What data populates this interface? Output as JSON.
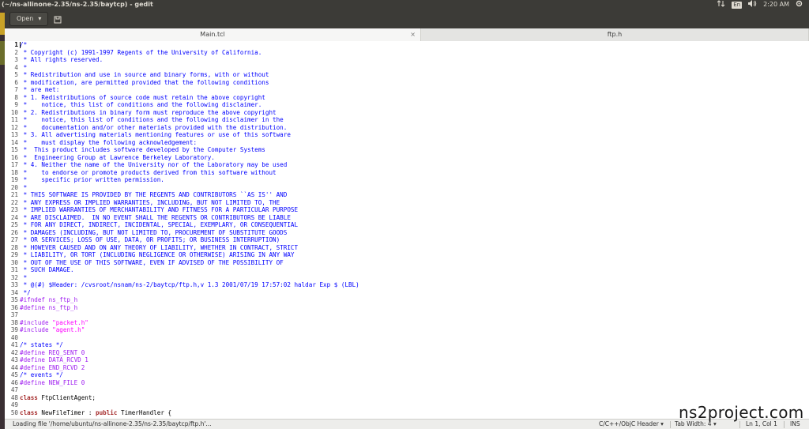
{
  "topbar": {
    "title": "(~/ns-allinone-2.35/ns-2.35/baytcp) - gedit",
    "lang": "En",
    "time": "2:20 AM"
  },
  "toolbar": {
    "open_label": "Open",
    "open_chevron": "▾"
  },
  "tabs": [
    {
      "label": "Main.tcl",
      "close": "×"
    },
    {
      "label": "ftp.h"
    }
  ],
  "lines": [
    {
      "n": "1",
      "t": "/*",
      "c": "c-comment"
    },
    {
      "n": "2",
      "t": " * Copyright (c) 1991-1997 Regents of the University of California.",
      "c": "c-comment"
    },
    {
      "n": "3",
      "t": " * All rights reserved.",
      "c": "c-comment"
    },
    {
      "n": "4",
      "t": " *",
      "c": "c-comment"
    },
    {
      "n": "5",
      "t": " * Redistribution and use in source and binary forms, with or without",
      "c": "c-comment"
    },
    {
      "n": "6",
      "t": " * modification, are permitted provided that the following conditions",
      "c": "c-comment"
    },
    {
      "n": "7",
      "t": " * are met:",
      "c": "c-comment"
    },
    {
      "n": "8",
      "t": " * 1. Redistributions of source code must retain the above copyright",
      "c": "c-comment"
    },
    {
      "n": "9",
      "t": " *    notice, this list of conditions and the following disclaimer.",
      "c": "c-comment"
    },
    {
      "n": "10",
      "t": " * 2. Redistributions in binary form must reproduce the above copyright",
      "c": "c-comment"
    },
    {
      "n": "11",
      "t": " *    notice, this list of conditions and the following disclaimer in the",
      "c": "c-comment"
    },
    {
      "n": "12",
      "t": " *    documentation and/or other materials provided with the distribution.",
      "c": "c-comment"
    },
    {
      "n": "13",
      "t": " * 3. All advertising materials mentioning features or use of this software",
      "c": "c-comment"
    },
    {
      "n": "14",
      "t": " *    must display the following acknowledgement:",
      "c": "c-comment"
    },
    {
      "n": "15",
      "t": " *  This product includes software developed by the Computer Systems",
      "c": "c-comment"
    },
    {
      "n": "16",
      "t": " *  Engineering Group at Lawrence Berkeley Laboratory.",
      "c": "c-comment"
    },
    {
      "n": "17",
      "t": " * 4. Neither the name of the University nor of the Laboratory may be used",
      "c": "c-comment"
    },
    {
      "n": "18",
      "t": " *    to endorse or promote products derived from this software without",
      "c": "c-comment"
    },
    {
      "n": "19",
      "t": " *    specific prior written permission.",
      "c": "c-comment"
    },
    {
      "n": "20",
      "t": " *",
      "c": "c-comment"
    },
    {
      "n": "21",
      "t": " * THIS SOFTWARE IS PROVIDED BY THE REGENTS AND CONTRIBUTORS ``AS IS'' AND",
      "c": "c-comment"
    },
    {
      "n": "22",
      "t": " * ANY EXPRESS OR IMPLIED WARRANTIES, INCLUDING, BUT NOT LIMITED TO, THE",
      "c": "c-comment"
    },
    {
      "n": "23",
      "t": " * IMPLIED WARRANTIES OF MERCHANTABILITY AND FITNESS FOR A PARTICULAR PURPOSE",
      "c": "c-comment"
    },
    {
      "n": "24",
      "t": " * ARE DISCLAIMED.  IN NO EVENT SHALL THE REGENTS OR CONTRIBUTORS BE LIABLE",
      "c": "c-comment"
    },
    {
      "n": "25",
      "t": " * FOR ANY DIRECT, INDIRECT, INCIDENTAL, SPECIAL, EXEMPLARY, OR CONSEQUENTIAL",
      "c": "c-comment"
    },
    {
      "n": "26",
      "t": " * DAMAGES (INCLUDING, BUT NOT LIMITED TO, PROCUREMENT OF SUBSTITUTE GOODS",
      "c": "c-comment"
    },
    {
      "n": "27",
      "t": " * OR SERVICES; LOSS OF USE, DATA, OR PROFITS; OR BUSINESS INTERRUPTION)",
      "c": "c-comment"
    },
    {
      "n": "28",
      "t": " * HOWEVER CAUSED AND ON ANY THEORY OF LIABILITY, WHETHER IN CONTRACT, STRICT",
      "c": "c-comment"
    },
    {
      "n": "29",
      "t": " * LIABILITY, OR TORT (INCLUDING NEGLIGENCE OR OTHERWISE) ARISING IN ANY WAY",
      "c": "c-comment"
    },
    {
      "n": "30",
      "t": " * OUT OF THE USE OF THIS SOFTWARE, EVEN IF ADVISED OF THE POSSIBILITY OF",
      "c": "c-comment"
    },
    {
      "n": "31",
      "t": " * SUCH DAMAGE.",
      "c": "c-comment"
    },
    {
      "n": "32",
      "t": " *",
      "c": "c-comment"
    },
    {
      "n": "33",
      "t": " * @(#) $Header: /cvsroot/nsnam/ns-2/baytcp/ftp.h,v 1.3 2001/07/19 17:57:02 haldar Exp $ (LBL)",
      "c": "c-comment"
    },
    {
      "n": "34",
      "t": " */",
      "c": "c-comment"
    },
    {
      "n": "35",
      "t": "#ifndef ns_ftp_h",
      "c": "c-pre"
    },
    {
      "n": "36",
      "t": "#define ns_ftp_h",
      "c": "c-pre"
    },
    {
      "n": "37",
      "t": "",
      "c": "c-plain"
    },
    {
      "n": "38",
      "parts": [
        {
          "t": "#include ",
          "c": "c-pre"
        },
        {
          "t": "\"packet.h\"",
          "c": "c-str"
        }
      ]
    },
    {
      "n": "39",
      "parts": [
        {
          "t": "#include ",
          "c": "c-pre"
        },
        {
          "t": "\"agent.h\"",
          "c": "c-str"
        }
      ]
    },
    {
      "n": "40",
      "t": "",
      "c": "c-plain"
    },
    {
      "n": "41",
      "t": "/* states */",
      "c": "c-comment"
    },
    {
      "n": "42",
      "t": "#define REQ_SENT 0",
      "c": "c-pre"
    },
    {
      "n": "43",
      "t": "#define DATA_RCVD 1",
      "c": "c-pre"
    },
    {
      "n": "44",
      "t": "#define END_RCVD 2",
      "c": "c-pre"
    },
    {
      "n": "45",
      "t": "/* events */",
      "c": "c-comment"
    },
    {
      "n": "46",
      "t": "#define NEW_FILE 0",
      "c": "c-pre"
    },
    {
      "n": "47",
      "t": "",
      "c": "c-plain"
    },
    {
      "n": "48",
      "parts": [
        {
          "t": "class",
          "c": "c-kw"
        },
        {
          "t": " FtpClientAgent;",
          "c": "c-plain"
        }
      ]
    },
    {
      "n": "49",
      "t": "",
      "c": "c-plain"
    },
    {
      "n": "50",
      "parts": [
        {
          "t": "class",
          "c": "c-kw"
        },
        {
          "t": " NewFileTimer : ",
          "c": "c-plain"
        },
        {
          "t": "public",
          "c": "c-kw"
        },
        {
          "t": " TimerHandler {",
          "c": "c-plain"
        }
      ]
    }
  ],
  "status": {
    "message": "Loading file '/home/ubuntu/ns-allinone-2.35/ns-2.35/baytcp/ftp.h'...",
    "language": "C/C++/ObjC Header",
    "tab_width": "Tab Width: 4",
    "position": "Ln 1, Col 1",
    "mode": "INS",
    "chevron": "▾"
  },
  "watermark": "ns2project.com",
  "colors": {
    "comment": "#0000ff",
    "preprocessor": "#a020f0",
    "string": "#ff00ff",
    "keyword": "#a52a2a",
    "topbar": "#3c3b37"
  }
}
